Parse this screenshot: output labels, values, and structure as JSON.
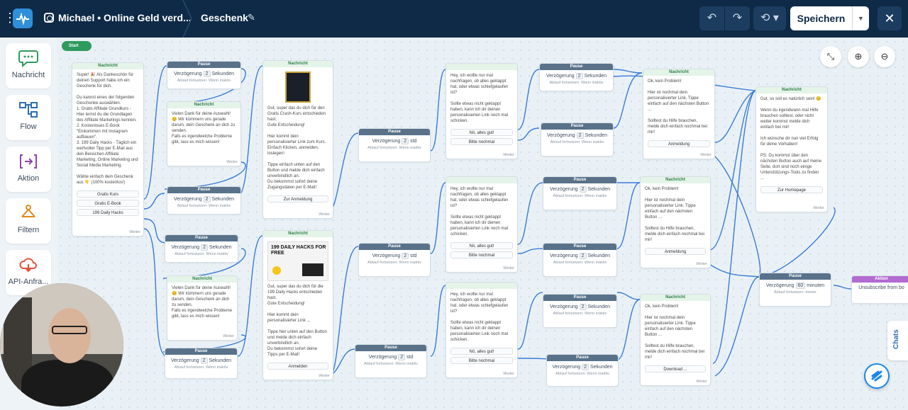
{
  "topbar": {
    "project": "Michael • Online Geld verd...",
    "flow_title": "Geschenk",
    "save_label": "Speichern"
  },
  "sidebar": {
    "items": [
      {
        "label": "Nachricht",
        "icon": "chat-bubble-icon"
      },
      {
        "label": "Flow",
        "icon": "flow-icon"
      },
      {
        "label": "Aktion",
        "icon": "action-icon"
      },
      {
        "label": "Filtern",
        "icon": "filter-icon"
      },
      {
        "label": "API-Anfra...",
        "icon": "cloud-api-icon"
      }
    ]
  },
  "canvas": {
    "start_label": "Start",
    "chats_label": "Chats",
    "weiter": "Weiter",
    "pause_header": "Pause",
    "msg_header": "Nachricht",
    "action_header": "Aktion",
    "delay_prefix": "Verzögerung",
    "resume_text": "Ablauf fortsetzen: Wenn inaktiv",
    "resume_always": "Ablauf fortsetzen: Immer"
  },
  "nodes": {
    "msg1": {
      "body": "Super! 🎉 Als Dankeschön für deinen Support habe ich ein Geschenk für dich.\n\nDu kannst eines der folgenden Geschenke auswählen:\n1. Gratis Affiliate Grundkurs - Hier lernst du die Grundlagen des Affiliate Marketings kennen.\n2. Kostenloses E-Book \"Einkommen mit Instagram aufbauen\".\n3. 199 Daily Hacks - Täglich ein wertvoller Tipp per E-Mail aus den Bereichen Affiliate Marketing, Online Marketing und Social Media Marketing.\n\nWähle einfach dein Geschenk aus 👇 (100% kostenlos!)",
      "buttons": [
        "Gratis Kurs",
        "Gratis E-Book",
        "199 Daily Hacks"
      ]
    },
    "p1": {
      "delay_num": "2",
      "delay_unit": "Sekunden"
    },
    "msg_thanks1": {
      "body": "Vielen Dank für deine Auswahl! 😊 Wir kümmern uns gerade darum, dein Geschenk an dich zu senden.\nFalls es irgendwelche Probleme gibt, lass es mich wissen!"
    },
    "p2": {
      "delay_num": "2",
      "delay_unit": "Sekunden"
    },
    "p3": {
      "delay_num": "2",
      "delay_unit": "Sekunden"
    },
    "msg_thanks2": {
      "body": "Vielen Dank für deine Auswahl! 😊 Wir kümmern uns gerade darum, dein Geschenk an dich zu senden.\nFalls es irgendwelche Probleme gibt, lass es mich wissen!"
    },
    "p4": {
      "delay_num": "2",
      "delay_unit": "Sekunden"
    },
    "msg_kurs": {
      "body": "Gut, super das du dich für den Gratis Crash-Kurs entschieden hast.\nGute Entscheidung!\n\nHier kommt dein personalisierter Link zum Kurs. Einfach Klicken, anmelden, loslegen!\n\nTippe einfach unten auf den Button und melde dich einfach unverbindlich an.\nDu bekommst sofort deine Zugangsdaten per E-Mail!",
      "button": "Zur Anmeldung"
    },
    "msg_hacks": {
      "image_title": "199 DAILY HACKS FOR FREE",
      "body": "Gut, super das du dich für die 199 Daily Hacks entschieden hast.\nGute Entscheidung!\n\nHier kommt dein personalisierter Link ...\n\nTippe hier unten auf den Button und melde dich einfach unverbindlich an.\nDu bekommst sofort deine Tipps per E-Mail!",
      "button": "Anmelden"
    },
    "p_std1": {
      "delay_num": "2",
      "delay_unit": "std"
    },
    "p_std2": {
      "delay_num": "2",
      "delay_unit": "std"
    },
    "p_std3": {
      "delay_num": "2",
      "delay_unit": "std"
    },
    "check1": {
      "body": "Hey, ich wollte nur mal nachfragen, ob alles geklappt hat, oder etwas schiefgelaufen ist?\n\nSollte etwas nicht geklappt haben, kann ich dir deinen personalisierten Link noch mal schicken.",
      "buttons": [
        "Nö, alles gut!",
        "Bitte nochmal"
      ]
    },
    "check2": {
      "body": "Hey, ich wollte nur mal nachfragen, ob alles geklappt hat, oder etwas schiefgelaufen ist?\n\nSollte etwas nicht geklappt haben, kann ich dir deinen personalisierten Link noch mal schicken.",
      "buttons": [
        "Nö, alles gut!",
        "Bitte nochmal"
      ]
    },
    "check3": {
      "body": "Hey, ich wollte nur mal nachfragen, ob alles geklappt hat, oder etwas schiefgelaufen ist?\n\nSollte etwas nicht geklappt haben, kann ich dir deinen personalisierten Link noch mal schicken.",
      "buttons": [
        "Nö, alles gut!",
        "Bitte nochmal"
      ]
    },
    "p5": {
      "delay_num": "2",
      "delay_unit": "Sekunden"
    },
    "p6": {
      "delay_num": "2",
      "delay_unit": "Sekunden"
    },
    "p7": {
      "delay_num": "2",
      "delay_unit": "Sekunden"
    },
    "p8": {
      "delay_num": "2",
      "delay_unit": "Sekunden"
    },
    "p9": {
      "delay_num": "2",
      "delay_unit": "Sekunden"
    },
    "p10": {
      "delay_num": "2",
      "delay_unit": "Sekunden"
    },
    "resend1": {
      "body": "Ok, kein Problem!\n\nHier ist nochmal dein personalisierter Link. Tippe einfach auf den nächsten Button ...\n\nSolltest du Hilfe brauchen, melde dich einfach nochmal bei mir!",
      "button": "Anmeldung"
    },
    "resend2": {
      "body": "Ok, kein Problem!\n\nHier ist nochmal dein personalisierter Link. Tippe einfach auf den nächsten Button ...\n\nSolltest du Hilfe brauchen, melde dich einfach nochmal bei mir!",
      "button": "Anmeldung"
    },
    "resend3": {
      "body": "Ok, kein Problem!\n\nHier ist nochmal dein personalisierter Link. Tippe einfach auf den nächsten Button ...\n\nSolltest du Hilfe brauchen, melde dich einfach nochmal bei mir!",
      "button": "Download ..."
    },
    "final_msg": {
      "body": "Gut, so soll es natürlich sein! 😊\n\nWenn du irgendwann mal Hilfe brauchen solltest, oder nicht weiter kommst melde dich einfach bei mir!\n\nIch wünsche dir nun viel Erfolg für deine Vorhaben!\n\nPS: Du kommst über den nächsten Button auch auf meine Seite, dort sind noch einige Unterstützungs-Tools zu finden ...",
      "button": "Zur Homepage"
    },
    "p60": {
      "delay_num": "60",
      "delay_unit": "minuten"
    },
    "unsub": {
      "label": "Unsubscribe from bo"
    }
  },
  "colors": {
    "topbar": "#0e2a47",
    "pause_header": "#59728a",
    "message_header": "#e4f4e8",
    "action_header": "#b26bd1",
    "link": "#3a7bd5",
    "start": "#2e9a5e"
  }
}
